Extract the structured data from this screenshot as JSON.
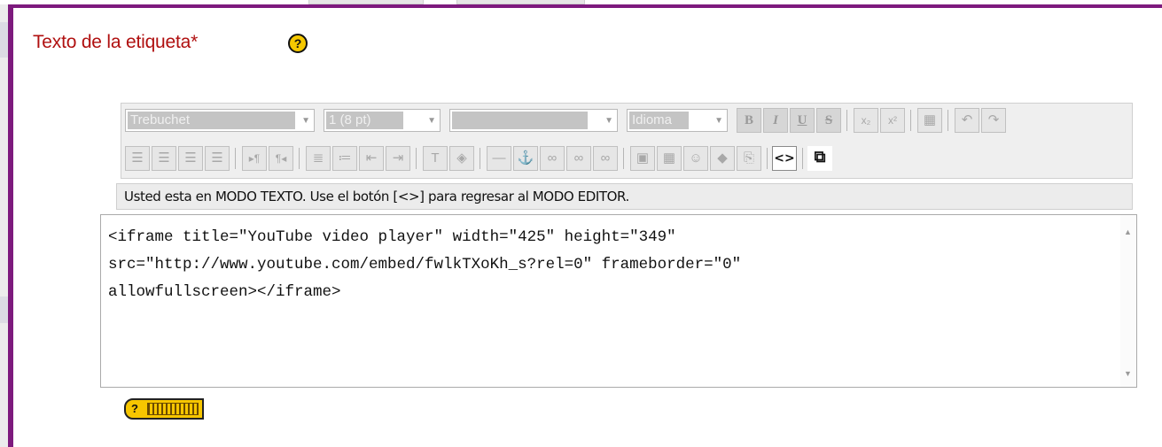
{
  "field": {
    "label": "Texto de la etiqueta*",
    "help_icon_glyph": "?"
  },
  "toolbar": {
    "font_family": "Trebuchet",
    "font_size": "1 (8 pt)",
    "heading": "",
    "language": "Idioma",
    "buttons_row1": [
      {
        "name": "bold-icon",
        "glyph": "B"
      },
      {
        "name": "italic-icon",
        "glyph": "I"
      },
      {
        "name": "underline-icon",
        "glyph": "U"
      },
      {
        "name": "strikethrough-icon",
        "glyph": "S"
      },
      {
        "name": "subscript-icon",
        "glyph": "x₂"
      },
      {
        "name": "superscript-icon",
        "glyph": "x²"
      },
      {
        "name": "paste-word-icon",
        "glyph": "▦"
      },
      {
        "name": "undo-icon",
        "glyph": "↶"
      },
      {
        "name": "redo-icon",
        "glyph": "↷"
      }
    ],
    "buttons_row2": [
      {
        "name": "align-left-icon",
        "glyph": "☰"
      },
      {
        "name": "align-center-icon",
        "glyph": "☰"
      },
      {
        "name": "align-right-icon",
        "glyph": "☰"
      },
      {
        "name": "justify-icon",
        "glyph": "☰"
      },
      {
        "name": "ltr-icon",
        "glyph": "▸¶"
      },
      {
        "name": "rtl-icon",
        "glyph": "¶◂"
      },
      {
        "name": "ordered-list-icon",
        "glyph": "≣"
      },
      {
        "name": "unordered-list-icon",
        "glyph": "≔"
      },
      {
        "name": "outdent-icon",
        "glyph": "⇤"
      },
      {
        "name": "indent-icon",
        "glyph": "⇥"
      },
      {
        "name": "text-color-icon",
        "glyph": "T"
      },
      {
        "name": "background-color-icon",
        "glyph": "◈"
      },
      {
        "name": "horizontal-rule-icon",
        "glyph": "—"
      },
      {
        "name": "anchor-icon",
        "glyph": "⚓"
      },
      {
        "name": "link-icon",
        "glyph": "∞"
      },
      {
        "name": "unlink-icon",
        "glyph": "∞"
      },
      {
        "name": "nolink-icon",
        "glyph": "∞"
      },
      {
        "name": "insert-image-icon",
        "glyph": "▣"
      },
      {
        "name": "insert-table-icon",
        "glyph": "▦"
      },
      {
        "name": "smiley-icon",
        "glyph": "☺"
      },
      {
        "name": "special-char-icon",
        "glyph": "◆"
      },
      {
        "name": "search-replace-icon",
        "glyph": "⎘"
      },
      {
        "name": "html-source-icon",
        "glyph": "<>"
      },
      {
        "name": "fullscreen-icon",
        "glyph": "⧉"
      }
    ]
  },
  "status_message": "Usted esta en MODO TEXTO. Use el botón [<>] para regresar al MODO EDITOR.",
  "editor": {
    "content": "<iframe title=\"YouTube video player\" width=\"425\" height=\"349\"\nsrc=\"http://www.youtube.com/embed/fwlkTXoKh_s?rel=0\" frameborder=\"0\"\nallowfullscreen></iframe>"
  },
  "keyboard_help": {
    "glyph": "?"
  }
}
